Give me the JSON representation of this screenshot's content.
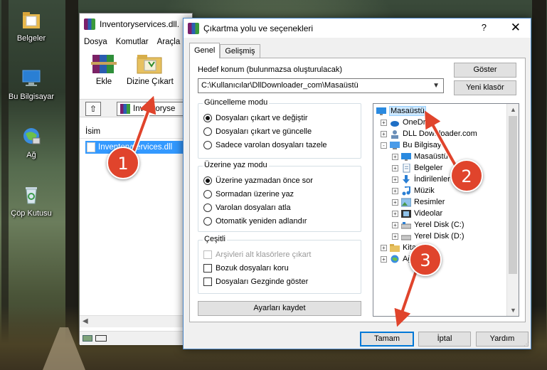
{
  "desktop": {
    "icons": [
      {
        "label": "Belgeler",
        "icon": "folder-documents-icon"
      },
      {
        "label": "Bu Bilgisayar",
        "icon": "computer-icon"
      },
      {
        "label": "Ağ",
        "icon": "network-icon"
      },
      {
        "label": "Çöp Kutusu",
        "icon": "recycle-bin-icon"
      }
    ]
  },
  "back_window": {
    "title": "Inventoryservices.dll.",
    "menu": [
      "Dosya",
      "Komutlar",
      "Araçla"
    ],
    "toolbar": {
      "add_label": "Ekle",
      "extract_label": "Dizine Çıkart"
    },
    "address": "Inventoryse",
    "list_header": "İsim",
    "selected_file": "Inventoryservices.dll"
  },
  "dialog": {
    "title": "Çıkartma yolu ve seçenekleri",
    "help": "?",
    "close": "✕",
    "tabs": [
      "Genel",
      "Gelişmiş"
    ],
    "target_label": "Hedef konum (bulunmazsa oluşturulacak)",
    "target_path": "C:\\Kullanıcılar\\DllDownloader_com\\Masaüstü",
    "show_button": "Göster",
    "new_folder_button": "Yeni klasör",
    "update_mode": {
      "title": "Güncelleme modu",
      "options": [
        "Dosyaları çıkart ve değiştir",
        "Dosyaları çıkart ve güncelle",
        "Sadece varolan dosyaları tazele"
      ],
      "selected": 0
    },
    "overwrite_mode": {
      "title": "Üzerine yaz modu",
      "options": [
        "Üzerine yazmadan önce sor",
        "Sormadan üzerine yaz",
        "Varolan dosyaları atla",
        "Otomatik yeniden adlandır"
      ],
      "selected": 0
    },
    "misc": {
      "title": "Çeşitli",
      "options": [
        "Arşivleri alt klasörlere çıkart",
        "Bozuk dosyaları koru",
        "Dosyaları Gezginde göster"
      ]
    },
    "save_settings_button": "Ayarları kaydet",
    "tree": [
      {
        "label": "Masaüstü",
        "level": 0,
        "icon": "desktop-icon",
        "selected": true
      },
      {
        "label": "OneDr",
        "level": 1,
        "icon": "cloud-icon",
        "expander": "+"
      },
      {
        "label": "DLL Downloader.com",
        "level": 1,
        "icon": "user-folder-icon",
        "expander": "+"
      },
      {
        "label": "Bu Bilgisaya",
        "level": 1,
        "icon": "computer-icon",
        "expander": "-"
      },
      {
        "label": "Masaüstü",
        "level": 2,
        "icon": "desktop-icon",
        "expander": "+"
      },
      {
        "label": "Belgeler",
        "level": 2,
        "icon": "documents-icon",
        "expander": "+"
      },
      {
        "label": "İndirilenler",
        "level": 2,
        "icon": "download-icon",
        "expander": "+"
      },
      {
        "label": "Müzik",
        "level": 2,
        "icon": "music-icon",
        "expander": "+"
      },
      {
        "label": "Resimler",
        "level": 2,
        "icon": "pictures-icon",
        "expander": "+"
      },
      {
        "label": "Videolar",
        "level": 2,
        "icon": "videos-icon",
        "expander": "+"
      },
      {
        "label": "Yerel Disk (C:)",
        "level": 2,
        "icon": "drive-icon",
        "expander": "+"
      },
      {
        "label": "Yerel Disk (D:)",
        "level": 2,
        "icon": "drive-icon",
        "expander": "+"
      },
      {
        "label": "Kitapl",
        "level": 1,
        "icon": "library-icon",
        "expander": "+"
      },
      {
        "label": "Ağ",
        "level": 1,
        "icon": "network-icon",
        "expander": "+"
      }
    ],
    "ok_button": "Tamam",
    "cancel_button": "İptal",
    "help_button": "Yardım"
  },
  "annotations": [
    "1",
    "2",
    "3"
  ],
  "colors": {
    "badge": "#e0442c",
    "selection": "#3399ff",
    "accent": "#0078d7"
  }
}
